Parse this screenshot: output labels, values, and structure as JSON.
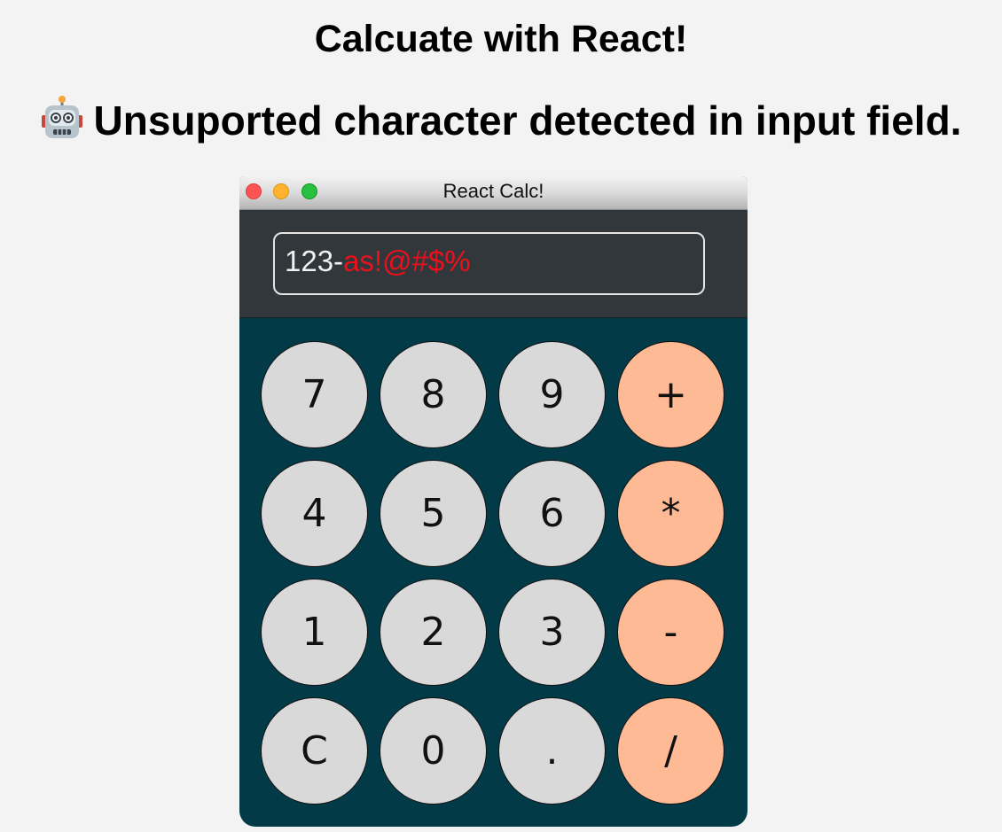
{
  "page": {
    "title": "Calcuate with React!",
    "error_message": "Unsuported character detected in input field."
  },
  "icons": {
    "error": "robot-face-icon"
  },
  "window": {
    "title": "React Calc!",
    "controls": [
      "close",
      "minimize",
      "maximize"
    ]
  },
  "display": {
    "valid_text": "123-",
    "invalid_text": "as!@#$%"
  },
  "keypad": {
    "rows": [
      [
        {
          "label": "7",
          "kind": "digit"
        },
        {
          "label": "8",
          "kind": "digit"
        },
        {
          "label": "9",
          "kind": "digit"
        },
        {
          "label": "+",
          "kind": "operator"
        }
      ],
      [
        {
          "label": "4",
          "kind": "digit"
        },
        {
          "label": "5",
          "kind": "digit"
        },
        {
          "label": "6",
          "kind": "digit"
        },
        {
          "label": "*",
          "kind": "operator"
        }
      ],
      [
        {
          "label": "1",
          "kind": "digit"
        },
        {
          "label": "2",
          "kind": "digit"
        },
        {
          "label": "3",
          "kind": "digit"
        },
        {
          "label": "-",
          "kind": "operator"
        }
      ],
      [
        {
          "label": "C",
          "kind": "clear"
        },
        {
          "label": "0",
          "kind": "digit"
        },
        {
          "label": ".",
          "kind": "digit"
        },
        {
          "label": "/",
          "kind": "operator"
        }
      ]
    ]
  },
  "colors": {
    "page_background": "#f3f3f3",
    "calculator_body": "#023a48",
    "display_background": "#31373b",
    "invalid_input_text": "#ee0f1d",
    "number_key": "#d9d9d9",
    "operator_key": "#fdba94"
  }
}
